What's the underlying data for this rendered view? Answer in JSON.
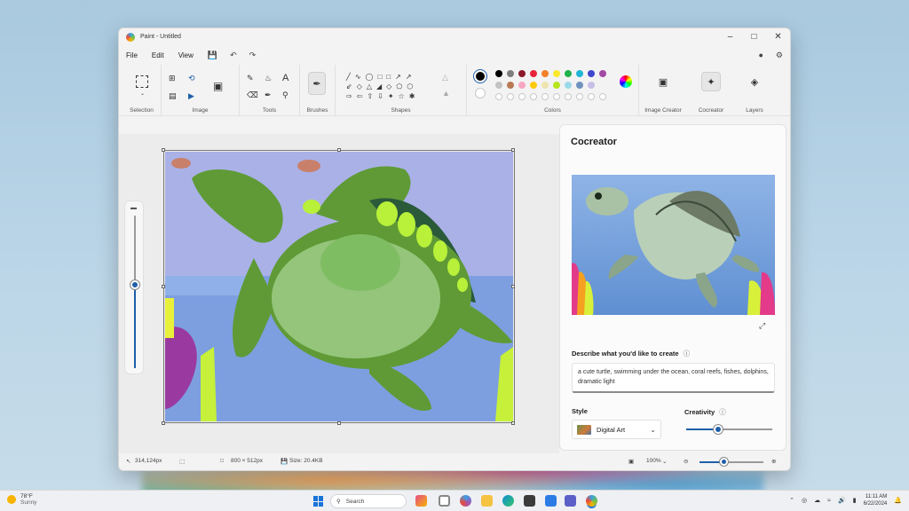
{
  "window": {
    "title": "Paint - Untitled"
  },
  "menu": [
    "File",
    "Edit",
    "View"
  ],
  "ribbon": {
    "groups": [
      "Selection",
      "Image",
      "Tools",
      "Brushes",
      "Shapes",
      "Colors",
      "Image Creator",
      "Cocreator",
      "Layers"
    ]
  },
  "colors": {
    "row1": [
      "#000000",
      "#7f7f7f",
      "#8b1a2b",
      "#e8233a",
      "#f57f2a",
      "#fbe92c",
      "#21b24b",
      "#21b5d6",
      "#3f48cc",
      "#a349a4"
    ],
    "row2": [
      "#c3c3c3",
      "#b97a56",
      "#f6a6c2",
      "#ffc90e",
      "#efe4b0",
      "#b5e61d",
      "#99d9ea",
      "#7092be",
      "#c8bfe7"
    ],
    "primary": "#000000",
    "secondary": "#ffffff"
  },
  "cocreator": {
    "title": "Cocreator",
    "describe_label": "Describe what you'd like to create",
    "prompt": "a cute turtle, swimming under the ocean, coral reefs, fishes, dolphins, dramatic light",
    "style_label": "Style",
    "style_value": "Digital Art",
    "creativity_label": "Creativity",
    "creativity_level": 0.37
  },
  "status": {
    "cursor": "314,124px",
    "canvas_size": "800 × 512px",
    "file_size": "Size: 20.4KB",
    "zoom": "100%",
    "zoom_level": 0.36
  },
  "brush_size_level": 0.5,
  "taskbar": {
    "weather_temp": "78°F",
    "weather_desc": "Sunny",
    "search_placeholder": "Search",
    "time": "11:11 AM",
    "date": "6/22/2024"
  }
}
